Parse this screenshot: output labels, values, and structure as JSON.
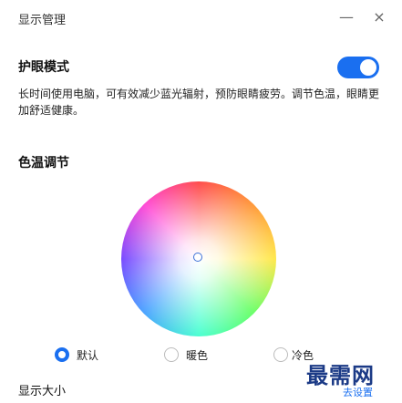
{
  "window": {
    "title": "显示管理",
    "minimize_label": "—",
    "close_label": "×"
  },
  "eye_protection": {
    "label": "护眼模式",
    "enabled": true,
    "description": "长时间使用电脑，可有效减少蓝光辐射，预防眼睛疲劳。调节色温，眼睛更加舒适健康。"
  },
  "color_temperature": {
    "label": "色温调节",
    "options": [
      {
        "label": "默认",
        "selected": true
      },
      {
        "label": "暖色",
        "selected": false
      },
      {
        "label": "冷色",
        "selected": false
      }
    ]
  },
  "display_size": {
    "label": "显示大小"
  },
  "watermark": {
    "brand_text": "最需网",
    "link_text": "去设置"
  }
}
